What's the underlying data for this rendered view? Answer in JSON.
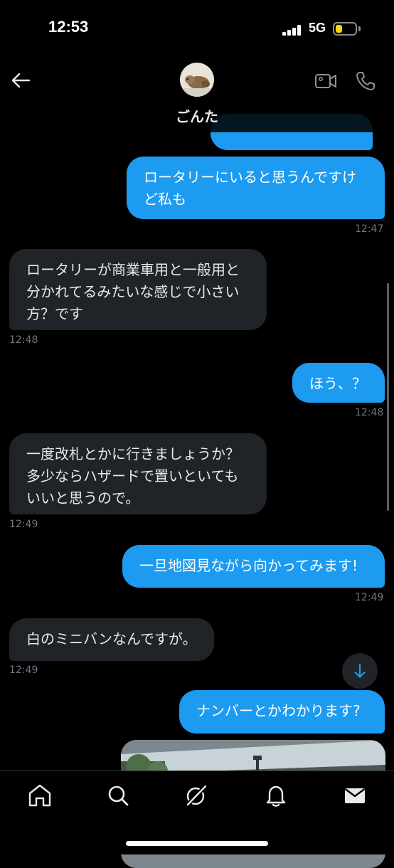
{
  "status_bar": {
    "time": "12:53",
    "network": "5G",
    "battery_level": 0.35
  },
  "header": {
    "contact_name": "ごんた"
  },
  "messages": [
    {
      "dir": "out",
      "text": "ロータリーにいると思うんですけ\nど私も",
      "time": "12:47"
    },
    {
      "dir": "in",
      "text": "ロータリーが商業車用と一般用と\n分かれてるみたいな感じで小さい\n方？です",
      "time": "12:48"
    },
    {
      "dir": "out",
      "text": "ほう、？",
      "time": "12:48"
    },
    {
      "dir": "in",
      "text": "一度改札とかに行きましょうか？\n多少ならハザードで置いといても\nいいと思うので。",
      "time": "12:49"
    },
    {
      "dir": "out",
      "text": "一旦地図見ながら向かってみます!",
      "time": "12:49"
    },
    {
      "dir": "in",
      "text": "白のミニバンなんですが。",
      "time": "12:49"
    },
    {
      "dir": "out",
      "text": "ナンバーとかわかります?",
      "time": ""
    }
  ],
  "tabs": [
    "home",
    "search",
    "grok",
    "notifications",
    "messages"
  ],
  "colors": {
    "outgoing": "#1d9bf0",
    "incoming": "#202327",
    "background": "#000000",
    "timestamp": "#71767b"
  }
}
